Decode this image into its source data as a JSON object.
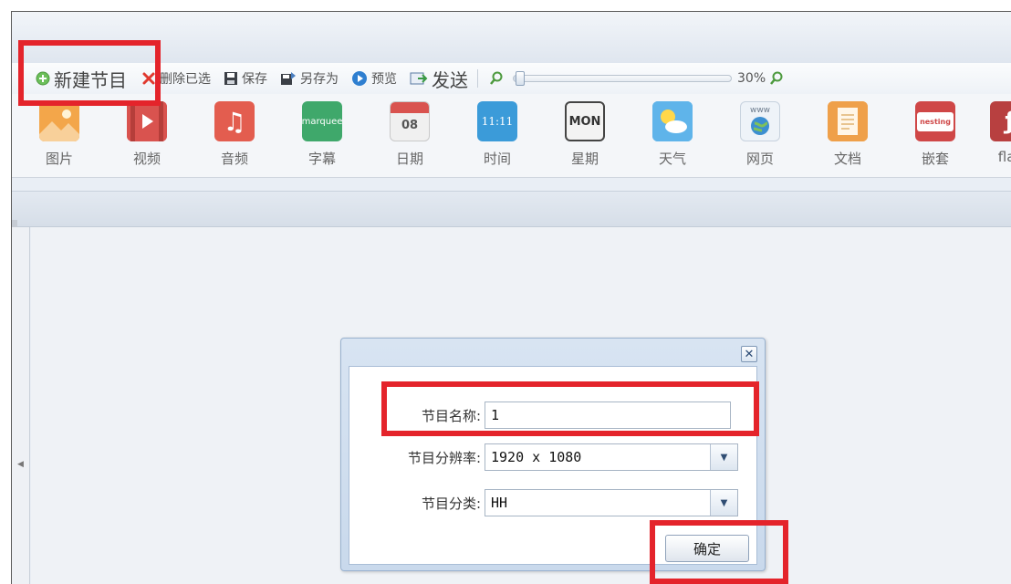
{
  "toolbar": {
    "new_program": "新建节目",
    "delete_selected": "删除已选",
    "save": "保存",
    "save_as": "另存为",
    "preview": "预览",
    "send": "发送",
    "zoom_percent": "30%",
    "zoom_level": 0.3
  },
  "palette": {
    "items": [
      {
        "label": "图片",
        "icon": "picture-icon"
      },
      {
        "label": "视频",
        "icon": "video-icon"
      },
      {
        "label": "音频",
        "icon": "audio-icon"
      },
      {
        "label": "字幕",
        "icon": "marquee-icon",
        "icon_text": "marquee"
      },
      {
        "label": "日期",
        "icon": "date-icon",
        "icon_text": "08"
      },
      {
        "label": "时间",
        "icon": "time-icon",
        "icon_text": "11:11"
      },
      {
        "label": "星期",
        "icon": "week-icon",
        "icon_text": "MON"
      },
      {
        "label": "天气",
        "icon": "weather-icon"
      },
      {
        "label": "网页",
        "icon": "webpage-icon",
        "icon_text": "www"
      },
      {
        "label": "文档",
        "icon": "document-icon"
      },
      {
        "label": "嵌套",
        "icon": "nesting-icon",
        "icon_text": "nesting"
      },
      {
        "label": "flas",
        "icon": "flash-icon"
      }
    ]
  },
  "dialog": {
    "close_glyph": "✕",
    "name_label": "节目名称:",
    "name_value": "1",
    "resolution_label": "节目分辨率:",
    "resolution_value": "1920 x 1080",
    "category_label": "节目分类:",
    "category_value": "HH",
    "confirm": "确定"
  },
  "colors": {
    "highlight": "#e4242b",
    "delete_red": "#e0392f",
    "picture_orange": "#f3a64a",
    "video_red": "#d9534f",
    "audio_red": "#e35d4f",
    "marquee_green": "#3fa86b",
    "date_red": "#d9534f",
    "time_blue": "#3b9bd9",
    "weather_blue": "#5fb4ea",
    "document_orange": "#efa04a",
    "nesting_red": "#cf4747"
  }
}
